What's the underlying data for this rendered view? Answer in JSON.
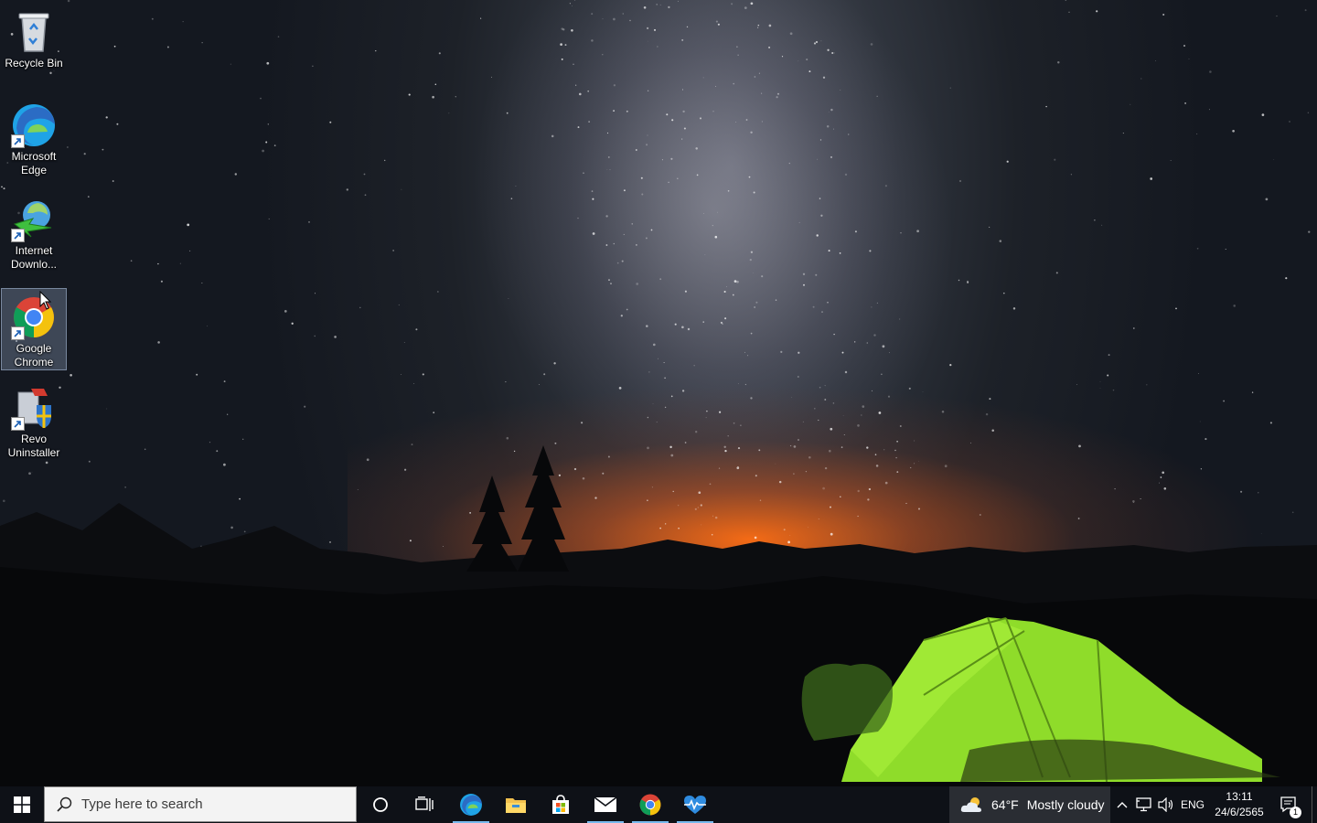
{
  "desktop": {
    "icons": [
      {
        "label_line1": "Recycle Bin",
        "label_line2": "",
        "icon": "recycle-bin-icon"
      },
      {
        "label_line1": "Microsoft",
        "label_line2": "Edge",
        "icon": "edge-icon"
      },
      {
        "label_line1": "Internet",
        "label_line2": "Downlo...",
        "icon": "internet-download-manager-icon"
      },
      {
        "label_line1": "Google",
        "label_line2": "Chrome",
        "icon": "chrome-icon",
        "selected": true
      },
      {
        "label_line1": "Revo",
        "label_line2": "Uninstaller",
        "icon": "revo-uninstaller-icon"
      }
    ]
  },
  "taskbar": {
    "search": {
      "placeholder": "Type here to search"
    },
    "pinned_apps": [
      {
        "name": "Microsoft Edge",
        "icon": "edge-icon",
        "running": true
      },
      {
        "name": "File Explorer",
        "icon": "folder-icon",
        "running": false
      },
      {
        "name": "Microsoft Store",
        "icon": "store-icon",
        "running": false
      },
      {
        "name": "Mail",
        "icon": "mail-icon",
        "running": true
      },
      {
        "name": "Google Chrome",
        "icon": "chrome-icon",
        "running": true
      },
      {
        "name": "Health monitor",
        "icon": "heartbeat-icon",
        "running": true
      }
    ],
    "weather": {
      "temp": "64°F",
      "condition": "Mostly cloudy",
      "icon": "partly-cloudy-icon"
    },
    "tray": {
      "language": "ENG"
    },
    "clock": {
      "time": "13:11",
      "date": "24/6/2565"
    },
    "notifications": {
      "count": "1"
    }
  },
  "colors": {
    "taskbar_bg": "#0e1117",
    "accent": "#76b9ed",
    "tent_green": "#8fdc2a"
  }
}
